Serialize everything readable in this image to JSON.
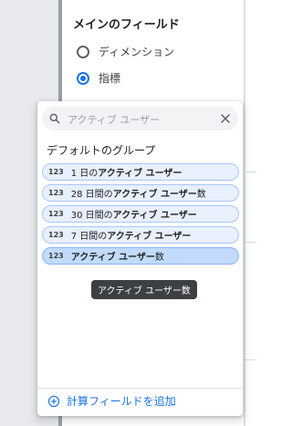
{
  "background_panel": {
    "title": "メインのフィールド",
    "radios": [
      {
        "label": "ディメンション",
        "checked": false
      },
      {
        "label": "指標",
        "checked": true
      }
    ]
  },
  "popup": {
    "search": {
      "placeholder": "アクティブ ユーザー",
      "value": ""
    },
    "group_title": "デフォルトのグループ",
    "chip_type_tag": "123",
    "items": [
      {
        "prefix": "1 日の",
        "bold": "アクティブ ユーザー",
        "suffix": "",
        "active": false
      },
      {
        "prefix": "28 日間の",
        "bold": "アクティブ ユーザー",
        "suffix": "数",
        "active": false
      },
      {
        "prefix": "30 日間の",
        "bold": "アクティブ ユーザー",
        "suffix": "",
        "active": false
      },
      {
        "prefix": "7 日間の",
        "bold": "アクティブ ユーザー",
        "suffix": "",
        "active": false
      },
      {
        "prefix": "",
        "bold": "アクティブ ユーザー",
        "suffix": "数",
        "active": true
      }
    ],
    "tooltip": "アクティブ ユーザー数",
    "add_field_label": "計算フィールドを追加"
  },
  "colors": {
    "accent": "#1a73e8",
    "chip_bg": "#e8f0fe",
    "chip_active_bg": "#c2dbfc",
    "tooltip_bg": "#3c4043"
  }
}
